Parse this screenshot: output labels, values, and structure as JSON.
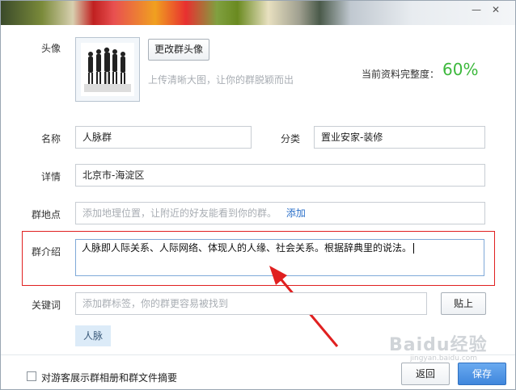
{
  "window": {
    "minimize_icon": "minimize-icon",
    "close_icon": "close-icon"
  },
  "avatar": {
    "label": "头像",
    "change_button": "更改群头像",
    "hint": "上传清晰大图，让你的群脱颖而出",
    "completeness_label": "当前资料完整度：",
    "completeness_value": "60%"
  },
  "fields": {
    "name_label": "名称",
    "name_value": "人脉群",
    "category_label": "分类",
    "category_value": "置业安家-装修",
    "detail_label": "详情",
    "detail_value": "北京市-海淀区",
    "location_label": "群地点",
    "location_placeholder": "添加地理位置，让附近的好友能看到你的群。",
    "location_add_link": "添加",
    "intro_label": "群介绍",
    "intro_value": "人脉即人际关系、人际网络、体现人的人缘、社会关系。根据辞典里的说法。",
    "keywords_label": "关键词",
    "keywords_placeholder": "添加群标签，你的群更容易被找到",
    "paste_button": "贴上",
    "tags": [
      "人脉"
    ]
  },
  "footer": {
    "checkbox_label": "对游客展示群相册和群文件摘要",
    "back_button": "返回",
    "save_button": "保存"
  },
  "watermark": {
    "text": "Baidu经验",
    "sub": "jingyan.baidu.com"
  },
  "colors": {
    "accent": "#3cb83c",
    "highlight": "#e02020",
    "primary_button": "#4a90e2",
    "link": "#2a6fc9"
  }
}
